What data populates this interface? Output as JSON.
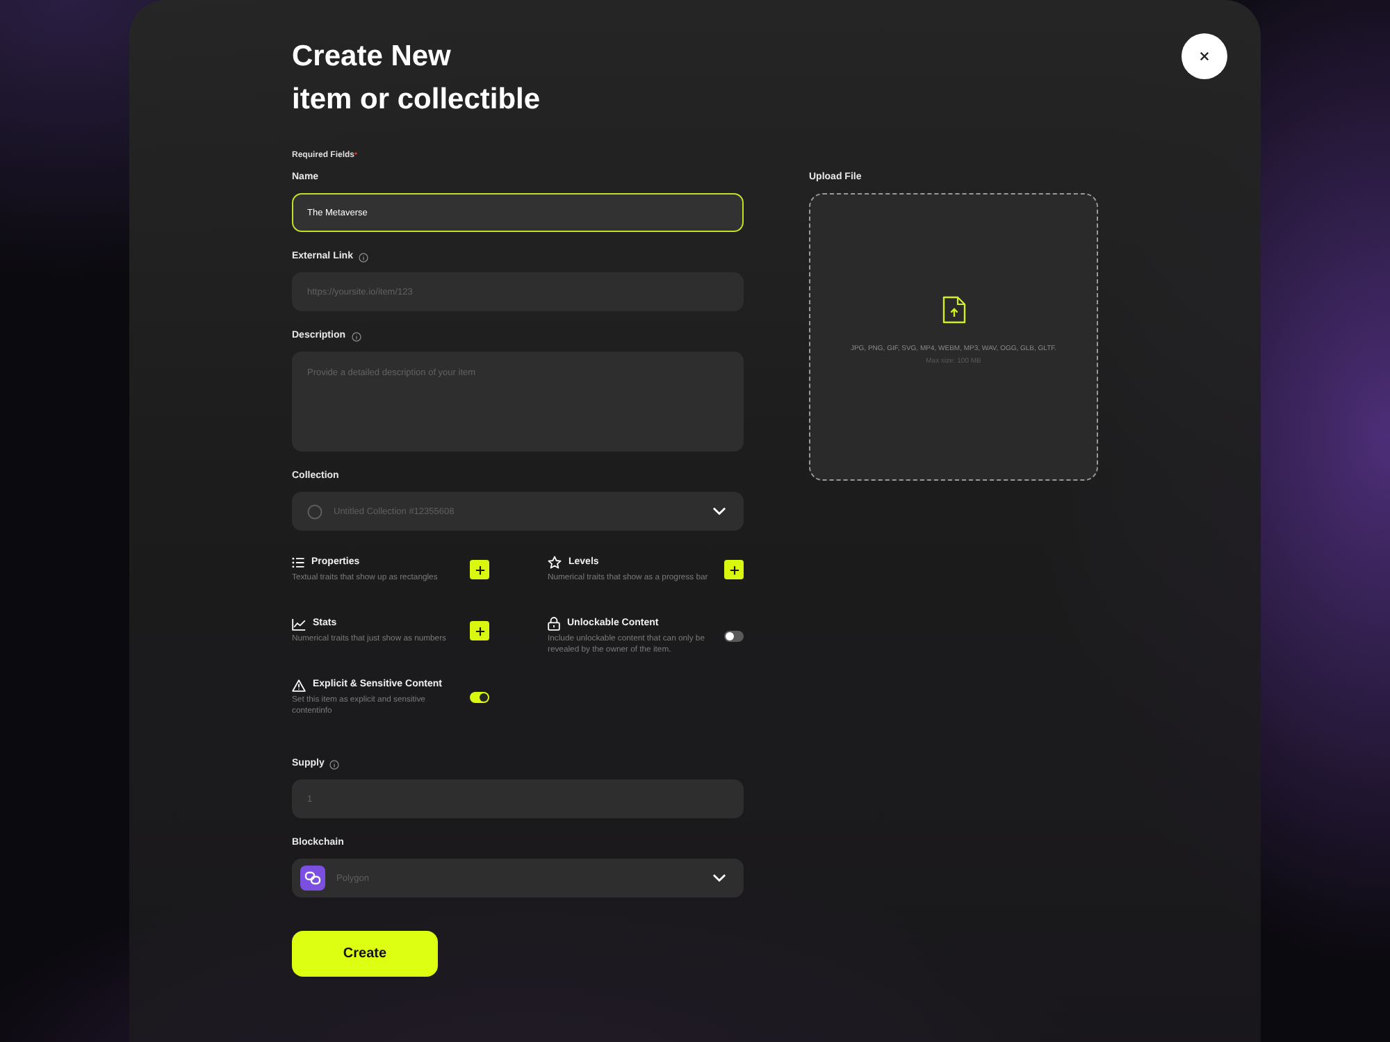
{
  "title_lines": [
    "Create New",
    "item or collectible"
  ],
  "required_note": {
    "text": "Required Fields",
    "mark": "*"
  },
  "fields": [
    {
      "kind": "input",
      "label": "Name",
      "info": false,
      "focused": true,
      "value": "The Metaverse"
    },
    {
      "kind": "input",
      "label": "External Link",
      "info": true,
      "focused": false,
      "placeholder": "https://yoursite.io/item/123"
    },
    {
      "kind": "textarea",
      "label": "Description",
      "info": true,
      "focused": false,
      "placeholder": "Provide a detailed description of your item"
    },
    {
      "kind": "dropdown",
      "label": "Collection",
      "info": false,
      "focused": false,
      "placeholder": "Untitled Collection #12355608"
    }
  ],
  "options": [
    {
      "kind": "add",
      "title": "Properties",
      "description": "Textual traits that show up as rectangles"
    },
    {
      "kind": "add",
      "title": "Levels",
      "description": "Numerical traits that show as a progress bar"
    },
    {
      "kind": "add",
      "title": "Stats",
      "description": "Numerical traits that just show as numbers"
    },
    {
      "kind": "toggle",
      "title": "Unlockable Content",
      "description": "Include unlockable content that can only be revealed by the owner of the item.",
      "on": false
    },
    {
      "kind": "toggle",
      "title": "Explicit & Sensitive Content",
      "description": "Set this item as explicit and sensitive contentinfo",
      "on": true
    }
  ],
  "more_fields": [
    {
      "kind": "input",
      "label": "Supply",
      "info": true,
      "focused": false,
      "placeholder": "1"
    },
    {
      "kind": "network",
      "label": "Blockchain",
      "info": false,
      "focused": false,
      "placeholder": "Polygon"
    }
  ],
  "create_button": "Create",
  "upload": {
    "label": "Upload File",
    "formats": "JPG, PNG, GIF, SVG, MP4, WEBM, MP3, WAV, OGG, GLB, GLTF.",
    "limit": "Max size: 100 MB"
  }
}
